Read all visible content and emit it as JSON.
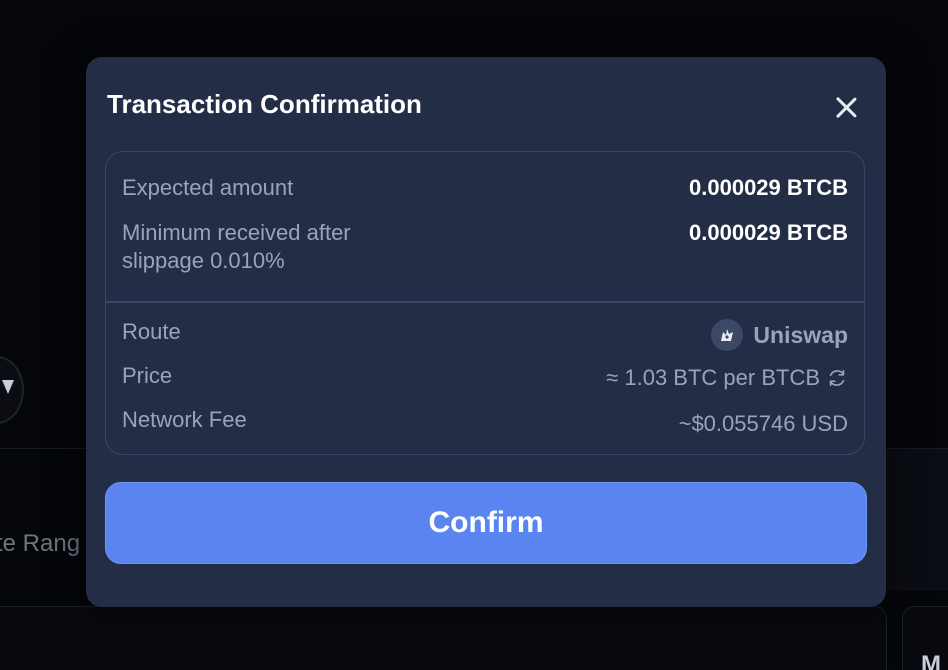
{
  "background": {
    "partial_text": "te Rang",
    "right_card_text": "M"
  },
  "modal": {
    "title": "Transaction Confirmation",
    "close_icon": "close-icon"
  },
  "details": {
    "expected_label": "Expected amount",
    "expected_value": "0.000029 BTCB",
    "minimum_label_line1": "Minimum received after",
    "minimum_label_line2": "slippage 0.010%",
    "minimum_value": "0.000029 BTCB",
    "route_label": "Route",
    "route_value": "Uniswap",
    "route_icon": "uniswap-icon",
    "price_label": "Price",
    "price_value": "≈ 1.03 BTC per BTCB",
    "price_icon": "refresh-icon",
    "fee_label": "Network Fee",
    "fee_value": "~$0.055746 USD"
  },
  "confirm": {
    "label": "Confirm"
  },
  "colors": {
    "modal_bg": "#232d45",
    "accent": "#5a85f0",
    "muted_text": "#99a4bc"
  }
}
